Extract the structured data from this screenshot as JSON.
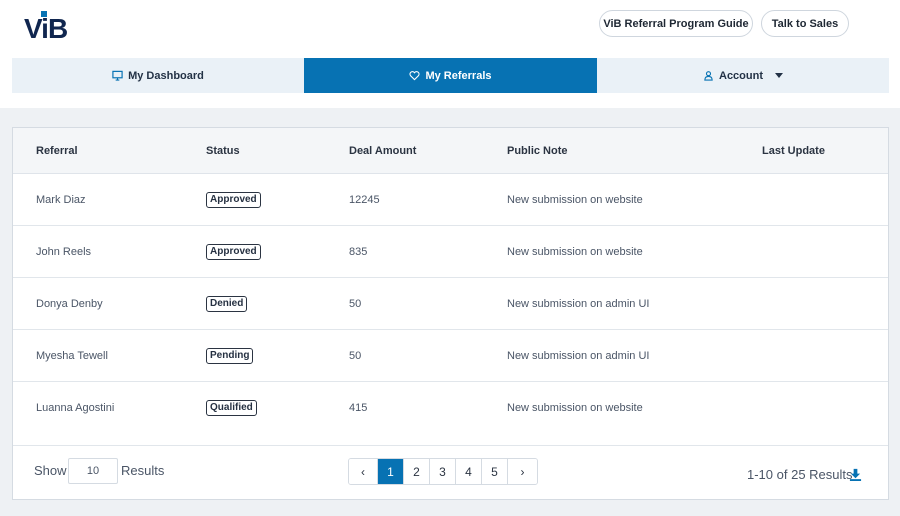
{
  "brand": {
    "logo_text": "ViB",
    "accent": "#0772b3",
    "navy": "#10264f"
  },
  "header": {
    "guide_button": "ViB Referral Program Guide",
    "sales_button": "Talk to Sales"
  },
  "nav": {
    "dashboard": {
      "label": "My Dashboard",
      "icon": "monitor-icon"
    },
    "referrals": {
      "label": "My Referrals",
      "icon": "heart-icon",
      "active": true
    },
    "account": {
      "label": "Account",
      "icon": "user-icon"
    }
  },
  "table": {
    "columns": [
      "Referral",
      "Status",
      "Deal Amount",
      "Public Note",
      "Last Update"
    ],
    "rows": [
      {
        "referral": "Mark Diaz",
        "status": "Approved",
        "amount": "12245",
        "note": "New submission on website",
        "last_update": ""
      },
      {
        "referral": "John Reels",
        "status": "Approved",
        "amount": "835",
        "note": "New submission on website",
        "last_update": ""
      },
      {
        "referral": "Donya Denby",
        "status": "Denied",
        "amount": "50",
        "note": "New submission on admin UI",
        "last_update": ""
      },
      {
        "referral": "Myesha Tewell",
        "status": "Pending",
        "amount": "50",
        "note": "New submission on admin UI",
        "last_update": ""
      },
      {
        "referral": "Luanna Agostini",
        "status": "Qualified",
        "amount": "415",
        "note": "New submission on website",
        "last_update": ""
      }
    ]
  },
  "footer": {
    "show_label": "Show",
    "page_size": "10",
    "results_label": "Results",
    "pagination": {
      "prev": "‹",
      "next": "›",
      "pages": [
        "1",
        "2",
        "3",
        "4",
        "5"
      ],
      "current": "1"
    },
    "count_text": "1-10 of 25 Results",
    "download_icon": "download-icon"
  }
}
